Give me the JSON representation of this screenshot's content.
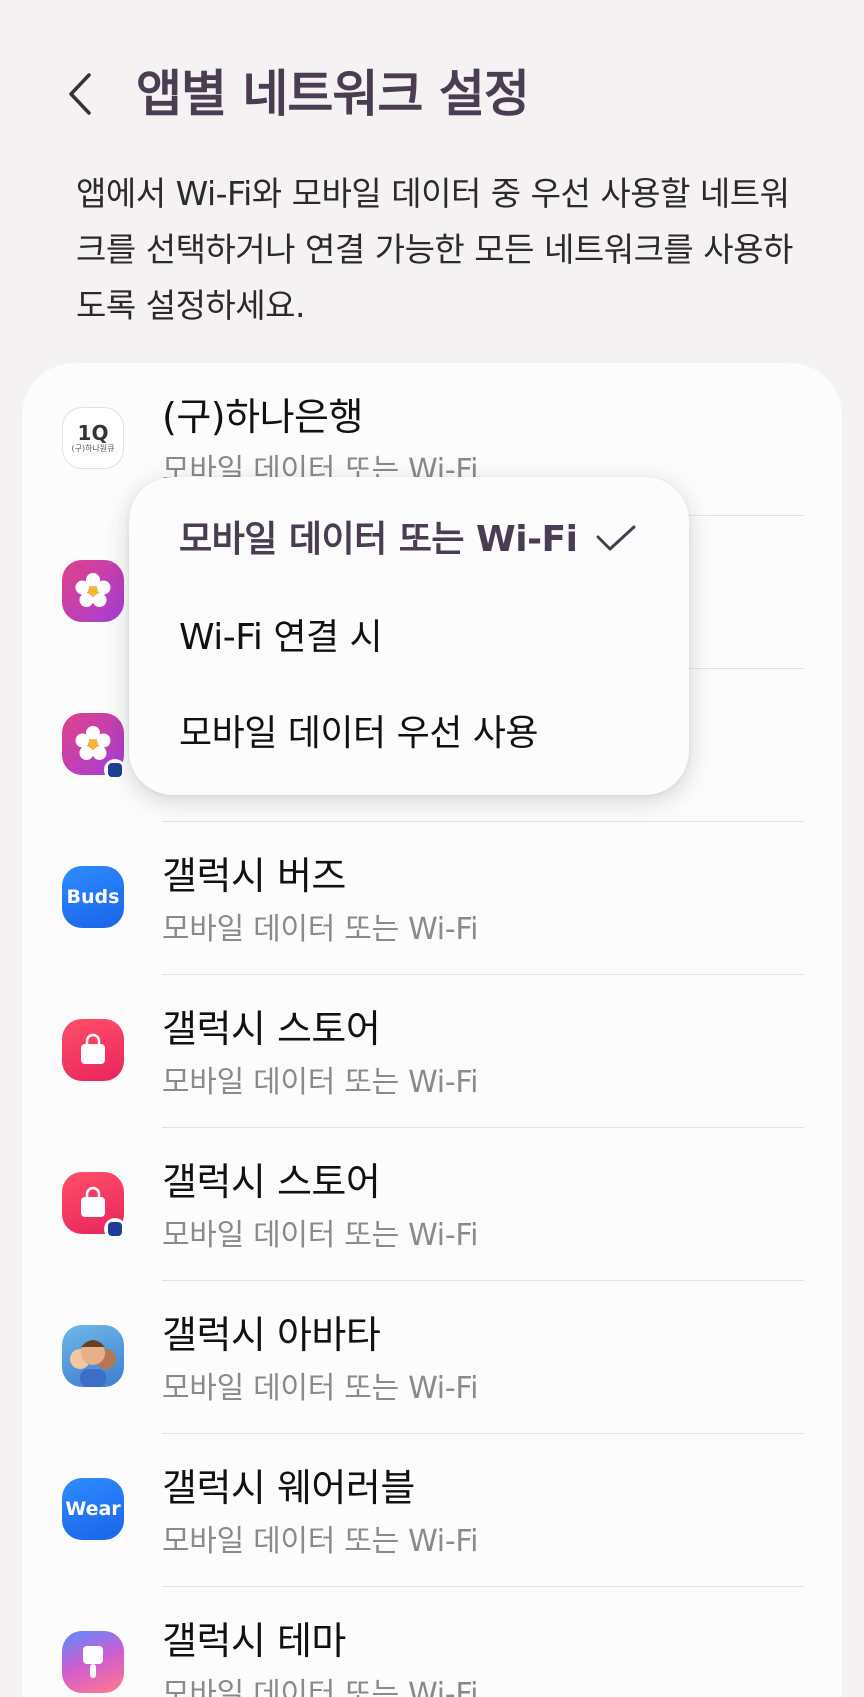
{
  "header": {
    "title": "앱별 네트워크 설정",
    "back_icon": "chevron-left-icon"
  },
  "description": "앱에서 Wi-Fi와 모바일 데이터 중 우선 사용할 네트워크를 선택하거나 연결 가능한 모든 네트워크를 사용하도록 설정하세요.",
  "apps": [
    {
      "name": "(구)하나은행",
      "setting": "모바일 데이터 또는 Wi-Fi",
      "icon": "hana-bank-icon",
      "icon_text": "1Q",
      "icon_subtext": "(구)하나원큐"
    },
    {
      "name": "",
      "setting": "",
      "icon": "gallery-icon"
    },
    {
      "name": "",
      "setting": "",
      "icon": "gallery-secure-icon"
    },
    {
      "name": "갤럭시 버즈",
      "setting": "모바일 데이터 또는 Wi-Fi",
      "icon": "buds-icon",
      "icon_text": "Buds"
    },
    {
      "name": "갤럭시 스토어",
      "setting": "모바일 데이터 또는 Wi-Fi",
      "icon": "galaxy-store-icon"
    },
    {
      "name": "갤럭시 스토어",
      "setting": "모바일 데이터 또는 Wi-Fi",
      "icon": "galaxy-store-secure-icon"
    },
    {
      "name": "갤럭시 아바타",
      "setting": "모바일 데이터 또는 Wi-Fi",
      "icon": "galaxy-avatar-icon"
    },
    {
      "name": "갤럭시 웨어러블",
      "setting": "모바일 데이터 또는 Wi-Fi",
      "icon": "wear-icon",
      "icon_text": "Wear"
    },
    {
      "name": "갤럭시 테마",
      "setting": "모바일 데이터 또는 Wi-Fi",
      "icon": "galaxy-themes-icon"
    }
  ],
  "dropdown": {
    "options": [
      {
        "label": "모바일 데이터 또는 Wi-Fi",
        "selected": true
      },
      {
        "label": "Wi-Fi 연결 시",
        "selected": false
      },
      {
        "label": "모바일 데이터 우선 사용",
        "selected": false
      }
    ],
    "check_icon": "check-icon"
  },
  "colors": {
    "background": "#f4f2f3",
    "card": "#fdfcfd",
    "title": "#4a3d52",
    "subtext": "#8a8a8a"
  }
}
